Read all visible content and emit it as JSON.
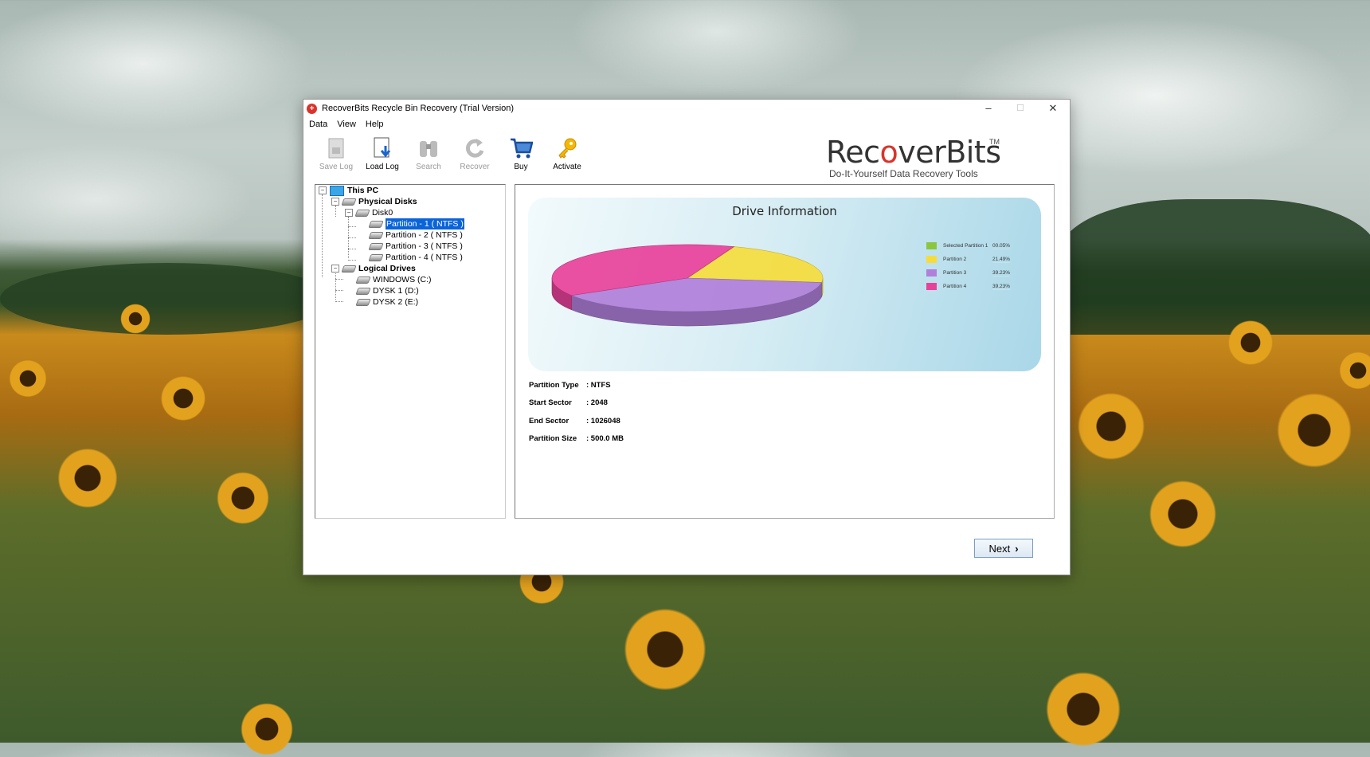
{
  "window": {
    "title": "RecoverBits Recycle Bin Recovery (Trial Version)",
    "controls": {
      "minimize": "–",
      "maximize": "☐",
      "close": "✕"
    }
  },
  "menu": [
    "Data",
    "View",
    "Help"
  ],
  "toolbar": [
    {
      "label": "Save Log",
      "icon": "save-log-icon",
      "enabled": false
    },
    {
      "label": "Load Log",
      "icon": "load-log-icon",
      "enabled": true
    },
    {
      "label": "Search",
      "icon": "binoculars-icon",
      "enabled": false
    },
    {
      "label": "Recover",
      "icon": "recover-icon",
      "enabled": false
    },
    {
      "label": "Buy",
      "icon": "cart-icon",
      "enabled": true
    },
    {
      "label": "Activate",
      "icon": "key-icon",
      "enabled": true
    }
  ],
  "logo": {
    "name_start": "Rec",
    "name_o": "o",
    "name_end": "verBits",
    "tm": "TM",
    "tagline": "Do-It-Yourself Data Recovery Tools"
  },
  "tree": {
    "root": "This PC",
    "physical": "Physical Disks",
    "disk": "Disk0",
    "partitions": [
      "Partition - 1 ( NTFS )",
      "Partition - 2 ( NTFS )",
      "Partition - 3 ( NTFS )",
      "Partition - 4 ( NTFS )"
    ],
    "logical": "Logical Drives",
    "drives": [
      "WINDOWS (C:)",
      "DYSK 1 (D:)",
      "DYSK 2 (E:)"
    ],
    "selected_index": 0
  },
  "chart_data": {
    "type": "pie",
    "title": "Drive Information",
    "series": [
      {
        "name": "Selected Partition 1",
        "value": 0.05,
        "label": "00.05%",
        "color": "#8cc63f"
      },
      {
        "name": "Partition 2",
        "value": 21.49,
        "label": "21.49%",
        "color": "#f5dc3c"
      },
      {
        "name": "Partition 3",
        "value": 39.23,
        "label": "39.23%",
        "color": "#b07fd9"
      },
      {
        "name": "Partition 4",
        "value": 39.23,
        "label": "39.23%",
        "color": "#e8419a"
      }
    ],
    "legend_position": "right"
  },
  "properties": [
    {
      "label": "Partition Type",
      "value": ": NTFS"
    },
    {
      "label": "Start Sector",
      "value": ": 2048"
    },
    {
      "label": "End Sector",
      "value": ": 1026048"
    },
    {
      "label": "Partition Size",
      "value": ": 500.0 MB"
    }
  ],
  "next_button": {
    "label": "Next",
    "icon": "chevron-right-icon",
    "glyph": "›"
  }
}
